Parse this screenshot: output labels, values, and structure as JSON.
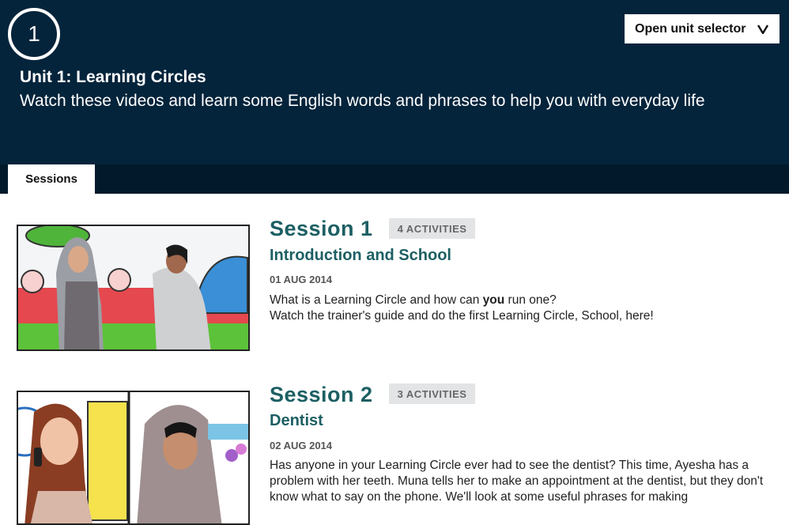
{
  "header": {
    "unit_number": "1",
    "unit_title": "Unit 1: Learning Circles",
    "unit_description": "Watch these videos and learn some English words and phrases to help you with everyday life",
    "selector_label": "Open unit selector",
    "selector_icon": "chevron-down-icon",
    "bg_color": "#03243b"
  },
  "tabs": [
    {
      "label": "Sessions",
      "active": true
    }
  ],
  "sessions": [
    {
      "title": "Session 1",
      "badge": "4 ACTIVITIES",
      "subtitle": "Introduction and School",
      "date": "01 AUG 2014",
      "desc_pre": "What is a Learning Circle and how can ",
      "desc_bold": "you",
      "desc_post": " run one?",
      "desc_line2": "Watch the trainer's guide and do the first Learning Circle, School, here!"
    },
    {
      "title": "Session 2",
      "badge": "3 ACTIVITIES",
      "subtitle": "Dentist",
      "date": "02 AUG 2014",
      "desc": "Has anyone in your Learning Circle ever had to see the dentist? This time, Ayesha has a problem with her teeth. Muna tells her to make an appointment at the dentist, but they don't know what to say on the phone. We'll look at some useful phrases for making"
    }
  ],
  "colors": {
    "accent": "#1c5f63",
    "badge_bg": "#e2e4e6"
  }
}
